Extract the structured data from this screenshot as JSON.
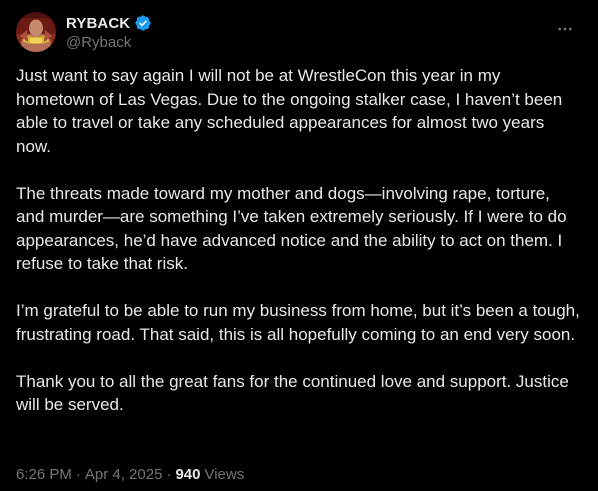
{
  "author": {
    "display_name": "RYBACK",
    "handle": "@Ryback",
    "verified": true,
    "verified_color": "#1d9bf0",
    "avatar_icon": "avatar-photo"
  },
  "more_icon": "more-horizontal-icon",
  "body": {
    "paragraphs": [
      "Just want to say again I will not be at WrestleCon this year in my hometown of Las Vegas. Due to the ongoing stalker case, I haven’t been able to travel or take any scheduled appearances for almost two years now.",
      "The threats made toward my mother and dogs—involving rape, torture, and murder—are something I’ve taken extremely seriously. If I were to do appearances, he’d have advanced notice and the ability to act on them. I refuse to take that risk.",
      "I’m grateful to be able to run my business from home, but it’s been a tough, frustrating road. That said, this is all hopefully coming to an end very soon.",
      "Thank you to all the great fans for the continued love and support. Justice will be served."
    ]
  },
  "meta": {
    "time": "6:26 PM",
    "separator": "·",
    "date": "Apr 4, 2025",
    "views_count": "940",
    "views_label": "Views"
  },
  "colors": {
    "background": "#000000",
    "text_primary": "#e7e9ea",
    "text_secondary": "#71767b"
  }
}
